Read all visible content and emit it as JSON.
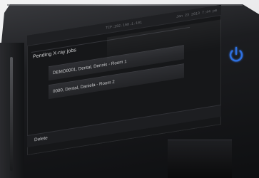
{
  "status_bar": {
    "ip": "TCP:192.168.1.101",
    "datetime": "Jan 23 2013  7:44 pm"
  },
  "jobs": {
    "title": "Pending X-ray jobs",
    "items": [
      {
        "label": "DEMO0001, Dental, Dennis - Room 1"
      },
      {
        "label": "0000, Dental, Daniela - Room 2"
      }
    ]
  },
  "actions": {
    "delete_label": "Delete"
  },
  "icons": {
    "power": "power-icon"
  },
  "colors": {
    "power_accent": "#2f6fe0",
    "screen_bg": "#161719",
    "row_bg": "#2a2b2f",
    "text": "#c9cacc"
  }
}
